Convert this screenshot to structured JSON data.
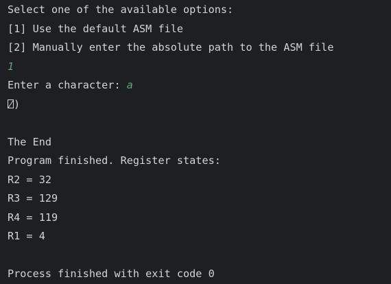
{
  "console": {
    "menu_prompt": "Select one of the available options:",
    "option_1": "[1] Use the default ASM file",
    "option_2": "[2] Manually enter the absolute path to the ASM file",
    "user_choice": "1",
    "char_prompt": "Enter a character: ",
    "user_char": "a",
    "output_after_glyph": ")",
    "end_text": "The End",
    "finished_text": "Program finished. Register states:",
    "registers": [
      "R2 = 32",
      "R3 = 129",
      "R4 = 119",
      "R1 = 4"
    ],
    "exit_text": "Process finished with exit code 0"
  },
  "colors": {
    "background": "#1e1f22",
    "text": "#d1d3d8",
    "user_input": "#5fa875"
  }
}
